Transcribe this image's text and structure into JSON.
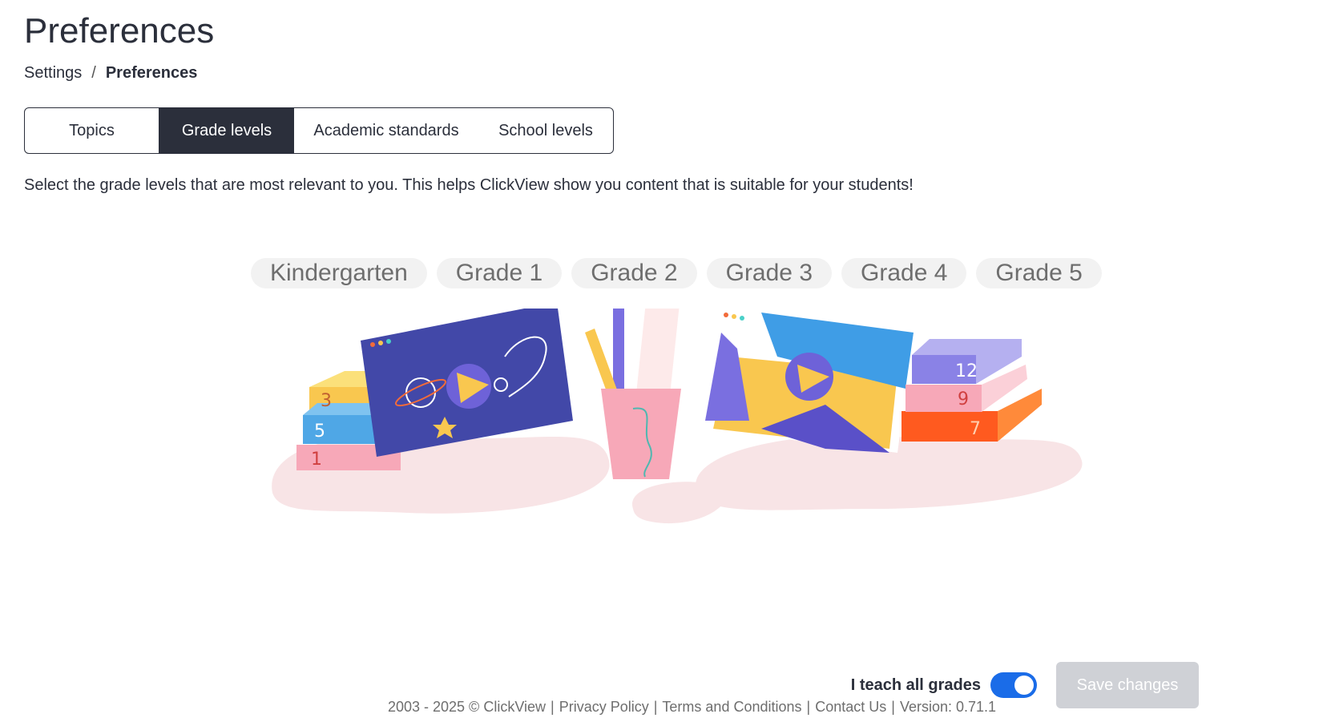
{
  "page": {
    "title": "Preferences"
  },
  "breadcrumb": {
    "parent": "Settings",
    "separator": "/",
    "current": "Preferences"
  },
  "tabs": [
    {
      "label": "Topics",
      "active": false
    },
    {
      "label": "Grade levels",
      "active": true
    },
    {
      "label": "Academic standards",
      "active": false
    },
    {
      "label": "School levels",
      "active": false
    }
  ],
  "description": "Select the grade levels that are most relevant to you. This helps ClickView show you content that is suitable for your students!",
  "grades": [
    {
      "label": "Kindergarten"
    },
    {
      "label": "Grade 1"
    },
    {
      "label": "Grade 2"
    },
    {
      "label": "Grade 3"
    },
    {
      "label": "Grade 4"
    },
    {
      "label": "Grade 5"
    }
  ],
  "illustration": {
    "book_numbers_left": [
      "3",
      "5",
      "1"
    ],
    "book_numbers_right": [
      "12",
      "9",
      "7"
    ]
  },
  "controls": {
    "toggle_label": "I teach all grades",
    "toggle_on": true,
    "save_label": "Save changes",
    "save_enabled": false
  },
  "footer": {
    "copyright": "2003 - 2025 © ClickView",
    "privacy": "Privacy Policy",
    "terms": "Terms and Conditions",
    "contact": "Contact Us",
    "version": "Version: 0.71.1"
  },
  "colors": {
    "primary_dark": "#2b2f3b",
    "toggle_blue": "#1a6ce8",
    "disabled_button": "#cfd1d6",
    "pill_bg": "#f2f2f2"
  }
}
